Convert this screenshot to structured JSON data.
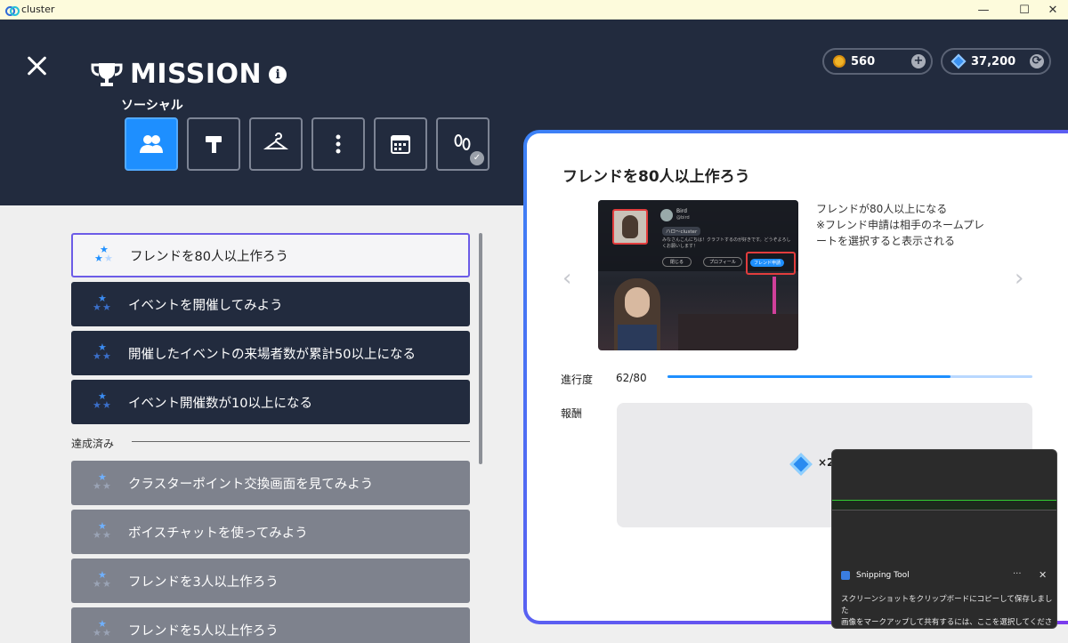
{
  "window": {
    "title": "cluster",
    "minimize": "—",
    "maximize": "☐",
    "close": "✕"
  },
  "header": {
    "title": "MISSION",
    "info": "i",
    "coins": "560",
    "gems": "37,200",
    "category_label": "ソーシャル",
    "tabs": [
      {
        "icon": "people-icon",
        "active": true
      },
      {
        "icon": "hammer-icon",
        "active": false
      },
      {
        "icon": "hanger-icon",
        "active": false
      },
      {
        "icon": "more-vertical-icon",
        "active": false
      },
      {
        "icon": "calendar-icon",
        "active": false
      },
      {
        "icon": "footprints-icon",
        "active": false
      }
    ]
  },
  "missions": {
    "active": [
      "フレンドを80人以上作ろう",
      "イベントを開催してみよう",
      "開催したイベントの来場者数が累計50以上になる",
      "イベント開催数が10以上になる"
    ],
    "completed_label": "達成済み",
    "completed": [
      "クラスターポイント交換画面を見てみよう",
      "ボイスチャットを使ってみよう",
      "フレンドを3人以上作ろう",
      "フレンドを5人以上作ろう"
    ]
  },
  "detail": {
    "title": "フレンドを80人以上作ろう",
    "desc_lines": [
      "フレンドが80人以上になる",
      "※フレンド申請は相手のネームプレ",
      "ートを選択すると表示される"
    ],
    "preview": {
      "name": "Bird",
      "handle": "@bird",
      "greeting": "ハロ〜cluster",
      "bio": "みなさんこんにちは！クラフトするのが好きです。どうぞよろしくお願いします！",
      "btn_close": "閉じる",
      "btn_profile": "プロフィール",
      "btn_friend": "フレンド申請"
    },
    "progress_label": "進行度",
    "progress_text": "62/80",
    "progress_fraction": 0.775,
    "reward_label": "報酬",
    "reward_count": "×2,"
  },
  "toast": {
    "app": "Snipping Tool",
    "more": "···",
    "close": "✕",
    "line1": "スクリーンショットをクリップボードにコピーして保存しました",
    "line2": "画像をマークアップして共有するには、ここを選択してください"
  },
  "colors": {
    "header": "#222b3e",
    "accent": "#1e8fff",
    "panel_border_start": "#3b82f6",
    "panel_border_end": "#7c3aed"
  }
}
